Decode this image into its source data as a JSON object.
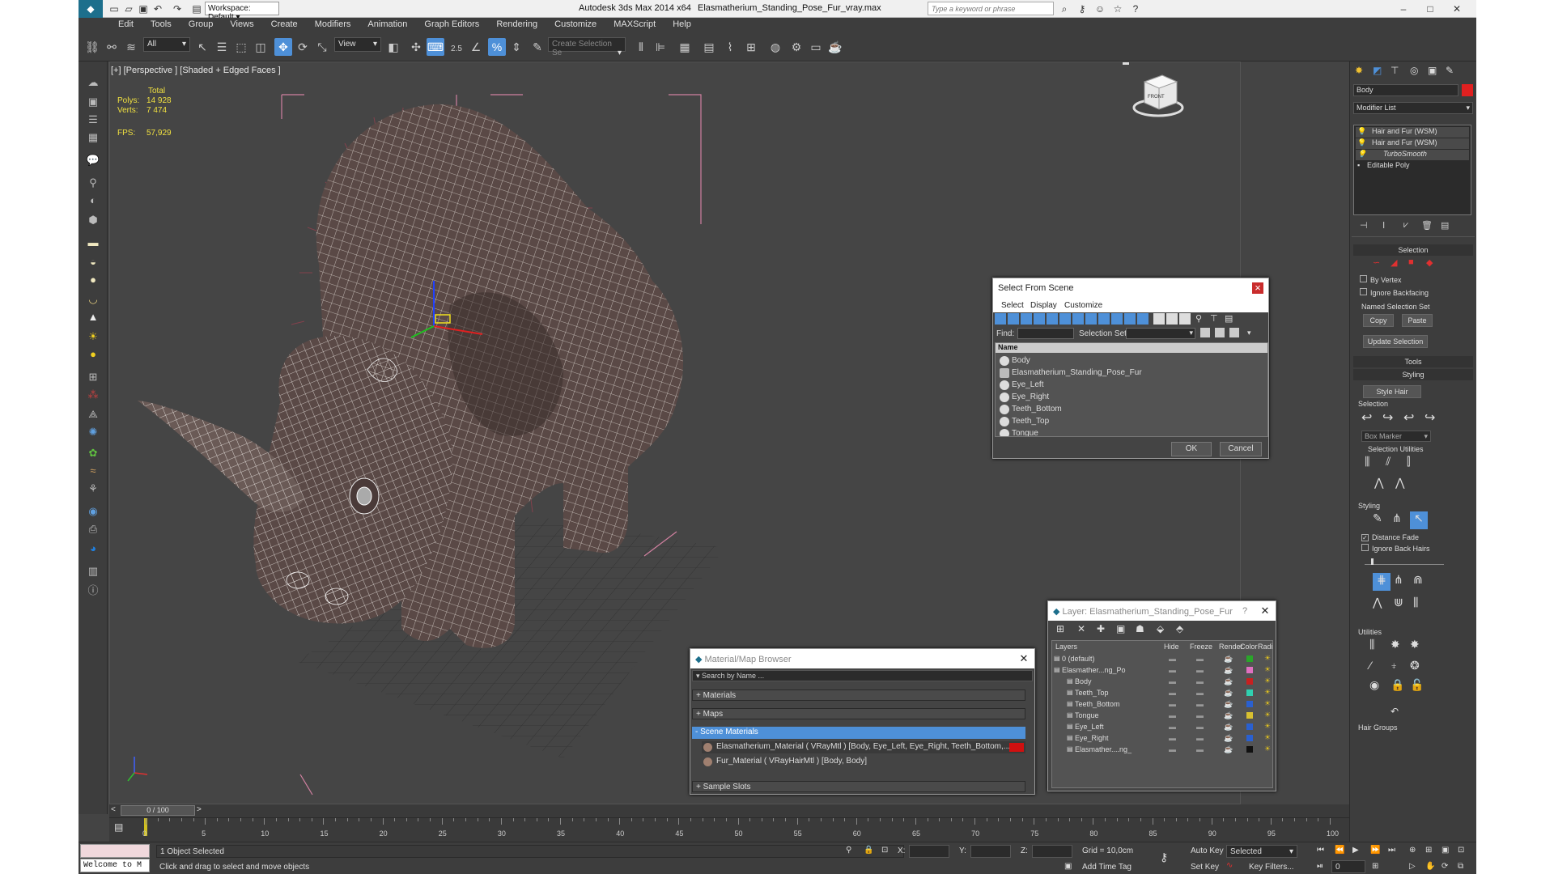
{
  "title": {
    "workspace": "Workspace: Default",
    "app": "Autodesk 3ds Max  2014 x64",
    "file": "Elasmatherium_Standing_Pose_Fur_vray.max",
    "search_placeholder": "Type a keyword or phrase"
  },
  "menu": [
    "Edit",
    "Tools",
    "Group",
    "Views",
    "Create",
    "Modifiers",
    "Animation",
    "Graph Editors",
    "Rendering",
    "Customize",
    "MAXScript",
    "Help"
  ],
  "toolbar": {
    "filter_value": "All",
    "refcoord_value": "View",
    "snap_label": "2.5",
    "selection_set_placeholder": "Create Selection Se"
  },
  "viewport": {
    "label": "[+] [Perspective ] [Shaded + Edged Faces ]",
    "stats": {
      "header": "Total",
      "polys_label": "Polys:",
      "polys": "14 928",
      "verts_label": "Verts:",
      "verts": "7 474",
      "fps_label": "FPS:",
      "fps": "57,929"
    },
    "viewcube_label": "FRONT"
  },
  "command_panel": {
    "object_name": "Body",
    "object_color": "#e02020",
    "modifier_list": "Modifier List",
    "stack": [
      "Hair and Fur (WSM)",
      "Hair and Fur (WSM)",
      "TurboSmooth",
      "Editable Poly"
    ],
    "selection_title": "Selection",
    "by_vertex": "By Vertex",
    "ignore_backfacing": "Ignore Backfacing",
    "named_selection_sets": "Named Selection Set",
    "copy": "Copy",
    "paste": "Paste",
    "update_selection": "Update Selection",
    "tools_title": "Tools",
    "styling_title": "Styling",
    "style_hair": "Style Hair",
    "selection_sub": "Selection",
    "box_marker": "Box Marker",
    "selection_utilities": "Selection Utilities",
    "styling_sub": "Styling",
    "distance_fade": "Distance Fade",
    "ignore_back_hairs": "Ignore Back Hairs",
    "utilities": "Utilities",
    "hair_groups": "Hair Groups"
  },
  "select_from_scene": {
    "title": "Select From Scene",
    "menu": [
      "Select",
      "Display",
      "Customize"
    ],
    "find_label": "Find:",
    "selection_set_label": "Selection Set:",
    "column_name": "Name",
    "items": [
      "Body",
      "Elasmatherium_Standing_Pose_Fur",
      "Eye_Left",
      "Eye_Right",
      "Teeth_Bottom",
      "Teeth_Top",
      "Tongue"
    ],
    "ok": "OK",
    "cancel": "Cancel"
  },
  "layer_dialog": {
    "title": "Layer: Elasmatherium_Standing_Pose_Fur",
    "help": "?",
    "columns": [
      "Layers",
      "Hide",
      "Freeze",
      "Render",
      "Color",
      "Radiosity"
    ],
    "layers": [
      {
        "name": "0 (default)",
        "color": "#2aa52a"
      },
      {
        "name": "Elasmather...ng_Po",
        "color": "#e070c0"
      },
      {
        "name": "Body",
        "color": "#c82020"
      },
      {
        "name": "Teeth_Top",
        "color": "#30d0b0"
      },
      {
        "name": "Teeth_Bottom",
        "color": "#2a60d0"
      },
      {
        "name": "Tongue",
        "color": "#d8c030"
      },
      {
        "name": "Eye_Left",
        "color": "#2a60d0"
      },
      {
        "name": "Eye_Right",
        "color": "#2a60d0"
      },
      {
        "name": "Elasmather....ng_",
        "color": "#111111"
      }
    ]
  },
  "material_browser": {
    "title": "Material/Map Browser",
    "search_placeholder": "Search by Name ...",
    "groups": [
      "+ Materials",
      "+ Maps",
      "- Scene Materials",
      "+ Sample Slots"
    ],
    "scene_materials": [
      "Elasmatherium_Material  ( VRayMtl ) [Body, Eye_Left, Eye_Right, Teeth_Bottom,...",
      "Fur_Material  ( VRayHairMtl ) [Body, Body]"
    ]
  },
  "timeline": {
    "frame": "0 / 100",
    "ticks": [
      "0",
      "5",
      "10",
      "15",
      "20",
      "25",
      "30",
      "35",
      "40",
      "45",
      "50",
      "55",
      "60",
      "65",
      "70",
      "75",
      "80",
      "85",
      "90",
      "95",
      "100"
    ]
  },
  "status": {
    "listener": "Welcome to M",
    "selected": "1 Object Selected",
    "prompt": "Click and drag to select and move objects",
    "x_label": "X:",
    "y_label": "Y:",
    "z_label": "Z:",
    "grid": "Grid = 10,0cm",
    "add_time_tag": "Add Time Tag",
    "auto_key": "Auto Key",
    "set_key": "Set Key",
    "selected_dd": "Selected",
    "key_filters": "Key Filters...",
    "frame_value": "0"
  }
}
